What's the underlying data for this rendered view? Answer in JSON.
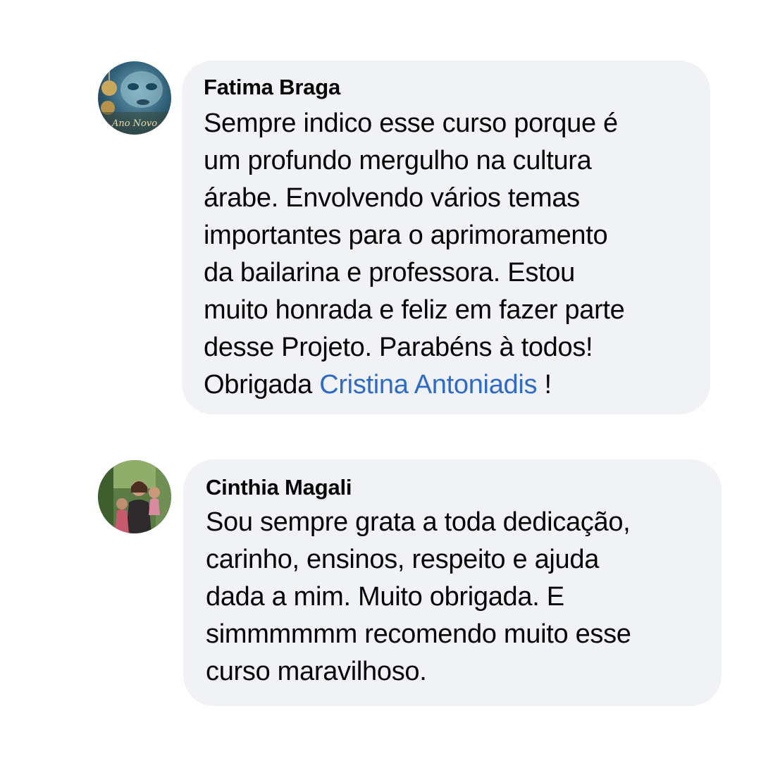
{
  "comments": [
    {
      "author": "Fatima Braga",
      "avatar_icon": "profile-photo",
      "avatar_caption": "Ano Novo",
      "text_lines": [
        "Sempre indico esse curso porque é",
        "um profundo mergulho na cultura",
        "árabe. Envolvendo vários temas",
        "importantes para o aprimoramento",
        "da bailarina e professora. Estou",
        "muito honrada e feliz em fazer parte",
        "desse Projeto.  Parabéns à todos!"
      ],
      "last_line_prefix": "Obrigada ",
      "mention": "Cristina Antoniadis",
      "last_line_suffix": " !"
    },
    {
      "author": "Cinthia Magali",
      "avatar_icon": "profile-photo",
      "text_lines": [
        "Sou sempre grata a toda dedicação,",
        "carinho, ensinos, respeito e ajuda",
        "dada a mim. Muito obrigada. E",
        "simmmmmm recomendo muito esse",
        "curso maravilhoso."
      ]
    }
  ],
  "colors": {
    "bubble_background": "#f0f2f5",
    "text": "#050505",
    "mention_link": "#2d6bc6"
  }
}
